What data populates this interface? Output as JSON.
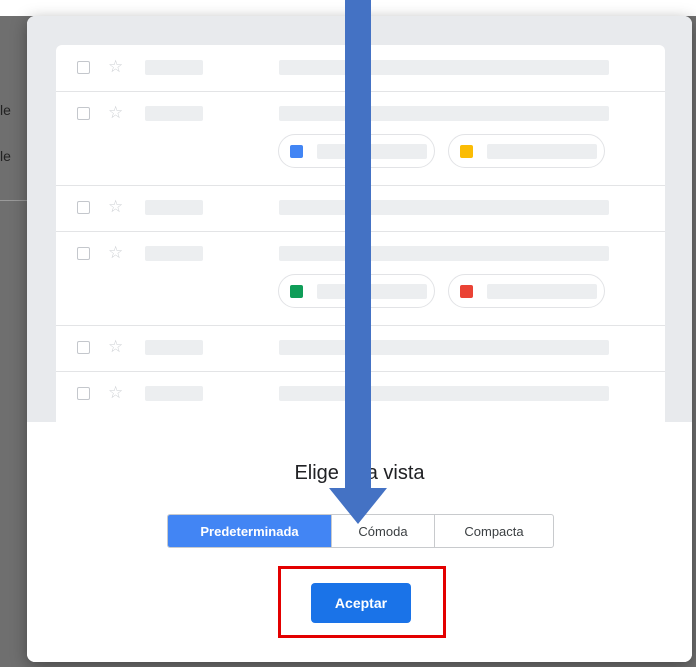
{
  "background": {
    "edge_chars": [
      "le",
      "le"
    ]
  },
  "preview": {
    "rows": [
      {
        "has_attachments": false
      },
      {
        "has_attachments": true,
        "attachments": [
          {
            "icon": "docs-icon",
            "color": "#4285f4"
          },
          {
            "icon": "slides-icon",
            "color": "#fbbc04"
          }
        ]
      },
      {
        "has_attachments": false
      },
      {
        "has_attachments": true,
        "attachments": [
          {
            "icon": "sheets-icon",
            "color": "#0f9d58"
          },
          {
            "icon": "photo-icon",
            "color": "#ea4335"
          }
        ]
      },
      {
        "has_attachments": false
      },
      {
        "has_attachments": false
      }
    ],
    "star_glyph": "☆"
  },
  "dialog": {
    "title": "Elige una vista",
    "options": [
      "Predeterminada",
      "Cómoda",
      "Compacta"
    ],
    "selected": "Predeterminada",
    "accept_label": "Aceptar"
  },
  "colors": {
    "accent": "#1a73e8",
    "selected_option": "#4285f4",
    "annotation_arrow": "#4472c4",
    "highlight_box": "#e30000"
  }
}
